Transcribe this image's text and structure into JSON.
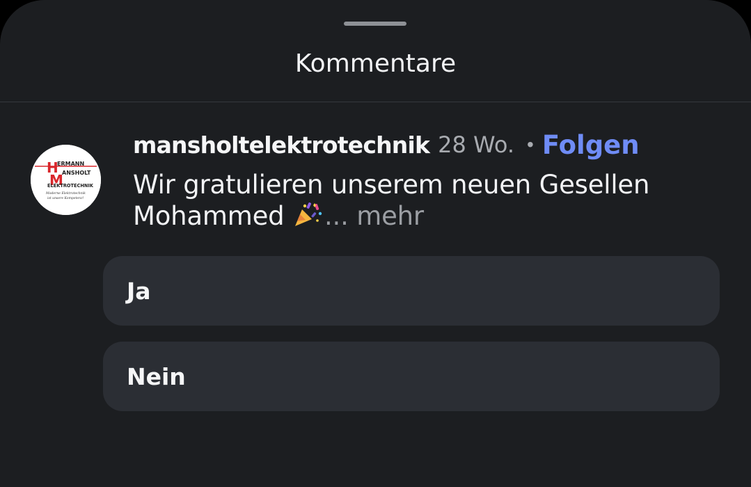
{
  "sheet": {
    "title": "Kommentare"
  },
  "comment": {
    "avatar": {
      "brand_lines": [
        "ERMANN",
        "ANSHOLT",
        "ELEKTROTECHNIK",
        "Moderne Elektrotechnik",
        "ist unsere Kompetenz!"
      ],
      "brand_color": "#d9262b"
    },
    "username": "mansholtelektrotechnik",
    "time": "28 Wo.",
    "separator": "•",
    "follow_label": "Folgen",
    "text_line1": "Wir gratulieren unserem neuen Gesellen",
    "text_line2_start": "Mohammed",
    "emoji": "party-popper-icon",
    "ellipsis": "...",
    "more_label": "mehr"
  },
  "reply_options": [
    {
      "label": "Ja"
    },
    {
      "label": "Nein"
    }
  ],
  "colors": {
    "sheet_background": "#1c1e21",
    "option_background": "#2b2e34",
    "accent_link": "#6f8cf6",
    "muted_text": "#a8abb0"
  }
}
